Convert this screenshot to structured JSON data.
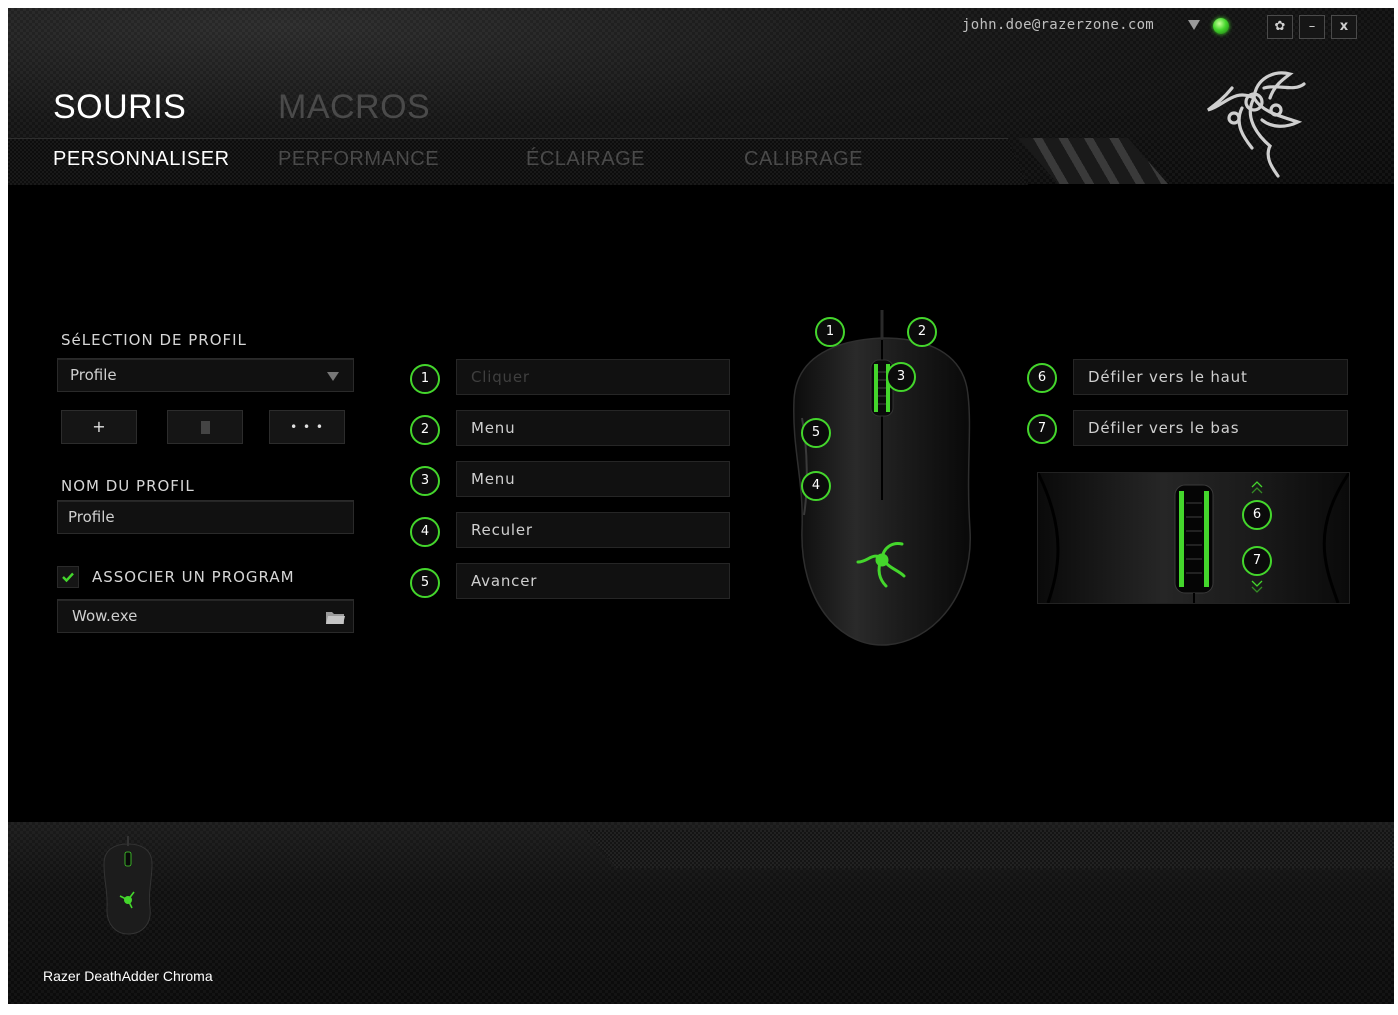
{
  "header": {
    "user_email": "john.doe@razerzone.com",
    "main_tabs": [
      {
        "label": "SOURIS",
        "active": true
      },
      {
        "label": "MACROS",
        "active": false
      }
    ],
    "sub_tabs": [
      {
        "label": "PERSONNALISER",
        "active": true
      },
      {
        "label": "PERFORMANCE",
        "active": false
      },
      {
        "label": "ÉCLAIRAGE",
        "active": false
      },
      {
        "label": "CALIBRAGE",
        "active": false
      }
    ],
    "window_buttons": {
      "settings": "✿",
      "minimize": "–",
      "close": "x"
    }
  },
  "profile": {
    "selection_label": "SéLECTION DE PROFIL",
    "selected_profile": "Profile",
    "add_label": "+",
    "more_label": "• • •",
    "name_label": "NOM DU PROFIL",
    "name_value": "Profile",
    "associate_label": "ASSOCIER UN PROGRAM",
    "associate_checked": true,
    "program_value": "Wow.exe"
  },
  "assignments": {
    "left": [
      {
        "num": "1",
        "label": "Cliquer",
        "disabled": true
      },
      {
        "num": "2",
        "label": "Menu",
        "disabled": false
      },
      {
        "num": "3",
        "label": "Menu",
        "disabled": false
      },
      {
        "num": "4",
        "label": "Reculer",
        "disabled": false
      },
      {
        "num": "5",
        "label": "Avancer",
        "disabled": false
      }
    ],
    "right": [
      {
        "num": "6",
        "label": "Défiler vers le haut"
      },
      {
        "num": "7",
        "label": "Défiler vers le bas"
      }
    ]
  },
  "mouse_callouts": [
    "1",
    "2",
    "3",
    "5",
    "4"
  ],
  "zoom_callouts": [
    "6",
    "7"
  ],
  "footer": {
    "device_name": "Razer DeathAdder Chroma"
  },
  "colors": {
    "accent": "#44d62c",
    "background": "#000000",
    "active_text": "#ffffff",
    "inactive_text": "#4a4a4a"
  }
}
